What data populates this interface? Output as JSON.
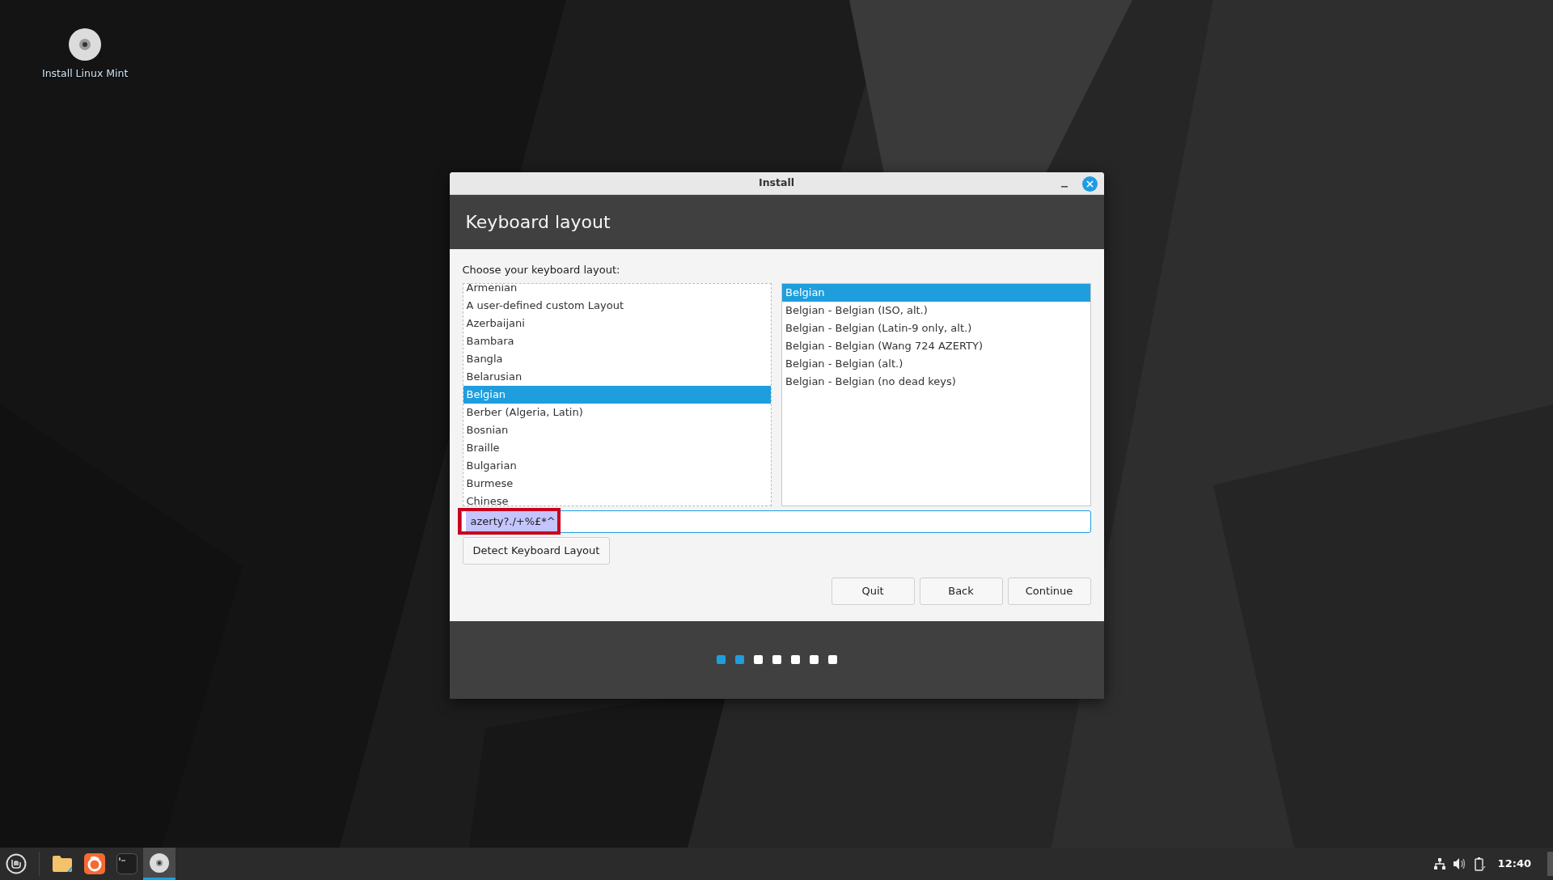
{
  "desktop": {
    "icons": [
      {
        "label": "Install Linux Mint"
      }
    ]
  },
  "window": {
    "title": "Install",
    "heading": "Keyboard layout",
    "prompt": "Choose your keyboard layout:",
    "layouts": [
      {
        "label": "Armenian",
        "selected": false
      },
      {
        "label": "A user-defined custom Layout",
        "selected": false
      },
      {
        "label": "Azerbaijani",
        "selected": false
      },
      {
        "label": "Bambara",
        "selected": false
      },
      {
        "label": "Bangla",
        "selected": false
      },
      {
        "label": "Belarusian",
        "selected": false
      },
      {
        "label": "Belgian",
        "selected": true
      },
      {
        "label": "Berber (Algeria, Latin)",
        "selected": false
      },
      {
        "label": "Bosnian",
        "selected": false
      },
      {
        "label": "Braille",
        "selected": false
      },
      {
        "label": "Bulgarian",
        "selected": false
      },
      {
        "label": "Burmese",
        "selected": false
      },
      {
        "label": "Chinese",
        "selected": false
      }
    ],
    "variants": [
      {
        "label": "Belgian",
        "selected": true
      },
      {
        "label": "Belgian - Belgian (ISO, alt.)",
        "selected": false
      },
      {
        "label": "Belgian - Belgian (Latin-9 only, alt.)",
        "selected": false
      },
      {
        "label": "Belgian - Belgian (Wang 724 AZERTY)",
        "selected": false
      },
      {
        "label": "Belgian - Belgian (alt.)",
        "selected": false
      },
      {
        "label": "Belgian - Belgian (no dead keys)",
        "selected": false
      }
    ],
    "test_field": {
      "value": "azerty?./+%£*^",
      "text_selected": true,
      "highlighted": true
    },
    "detect_button": "Detect Keyboard Layout",
    "buttons": [
      "Quit",
      "Back",
      "Continue"
    ],
    "steps": [
      {
        "done": true
      },
      {
        "done": true
      },
      {
        "done": false
      },
      {
        "done": false
      },
      {
        "done": false
      },
      {
        "done": false
      },
      {
        "done": false
      }
    ]
  },
  "taskbar": {
    "apps": [
      {
        "kind": "files",
        "active": false
      },
      {
        "kind": "browser",
        "active": false
      },
      {
        "kind": "terminal",
        "active": false
      },
      {
        "kind": "disc",
        "active": true
      }
    ],
    "clock": "12:40"
  }
}
